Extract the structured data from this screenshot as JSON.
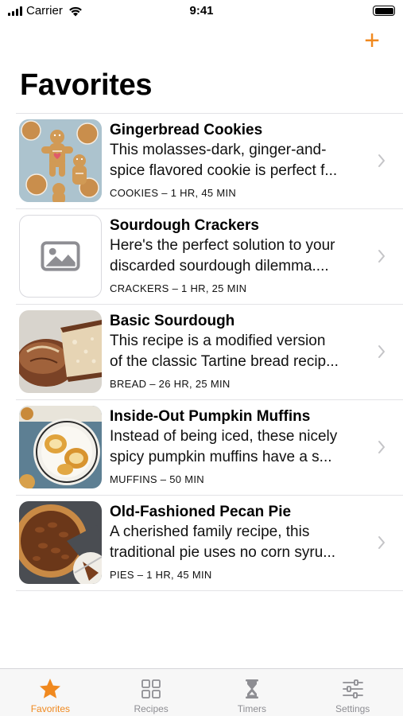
{
  "status_bar": {
    "carrier": "Carrier",
    "time": "9:41"
  },
  "nav": {
    "add_label": "+"
  },
  "page_title": "Favorites",
  "accent_color": "#f0891f",
  "recipes": [
    {
      "title": "Gingerbread Cookies",
      "desc_line1": "This molasses-dark, ginger-and-",
      "desc_line2": "spice flavored cookie is perfect f...",
      "category": "COOKIES",
      "separator": "–",
      "time": "1 HR, 45 MIN",
      "image": "gingerbread-cookies-photo"
    },
    {
      "title": "Sourdough Crackers",
      "desc_line1": "Here's the perfect solution to your",
      "desc_line2": "discarded sourdough dilemma....",
      "category": "CRACKERS",
      "separator": "–",
      "time": "1 HR, 25 MIN",
      "image": "photo-placeholder-icon"
    },
    {
      "title": "Basic Sourdough",
      "desc_line1": "This recipe is a modified version",
      "desc_line2": "of the classic Tartine bread recip...",
      "category": "BREAD",
      "separator": "–",
      "time": "26 HR, 25 MIN",
      "image": "sourdough-bread-photo"
    },
    {
      "title": "Inside-Out Pumpkin Muffins",
      "desc_line1": "Instead of being iced, these nicely",
      "desc_line2": "spicy pumpkin muffins have a s...",
      "category": "MUFFINS",
      "separator": "–",
      "time": "50 MIN",
      "image": "pumpkin-muffins-photo"
    },
    {
      "title": "Old-Fashioned Pecan Pie",
      "desc_line1": "A cherished family recipe, this",
      "desc_line2": "traditional pie uses no corn syru...",
      "category": "PIES",
      "separator": "–",
      "time": "1 HR, 45 MIN",
      "image": "pecan-pie-photo"
    }
  ],
  "tabs": [
    {
      "label": "Favorites",
      "icon": "star-icon",
      "active": true
    },
    {
      "label": "Recipes",
      "icon": "grid-icon",
      "active": false
    },
    {
      "label": "Timers",
      "icon": "hourglass-icon",
      "active": false
    },
    {
      "label": "Settings",
      "icon": "sliders-icon",
      "active": false
    }
  ]
}
